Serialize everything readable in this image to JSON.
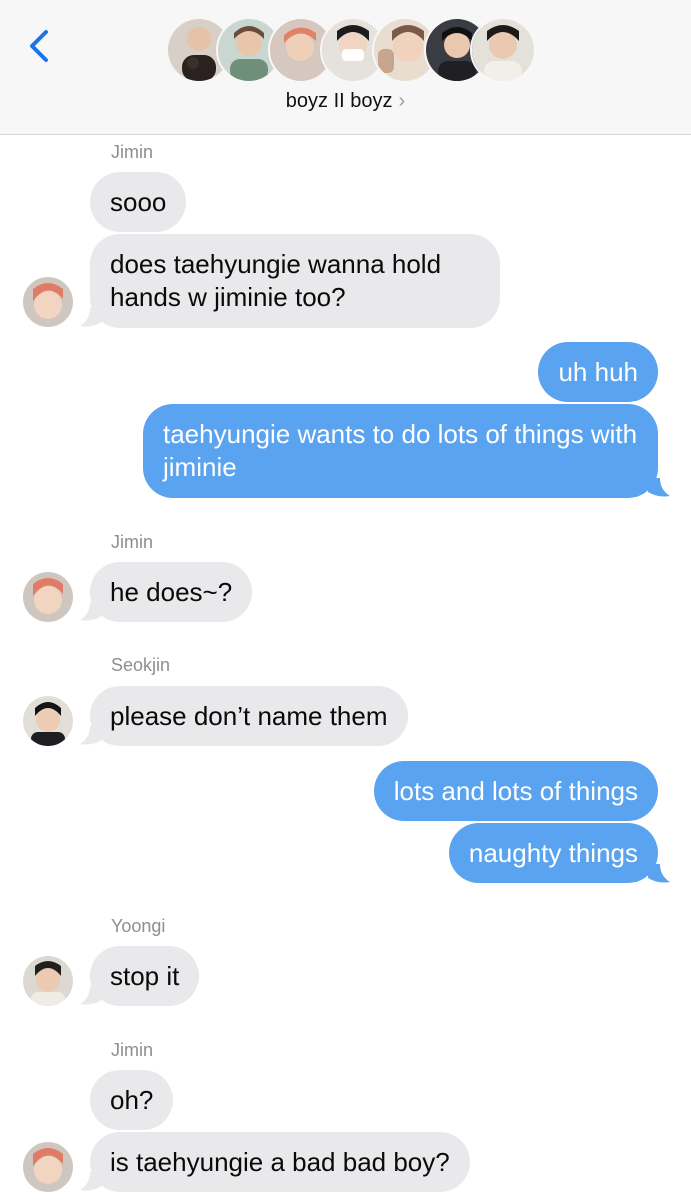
{
  "header": {
    "title": "boyz II boyz",
    "title_chevron": "›",
    "back_icon": "chevron-left-icon",
    "avatars": [
      "member-1",
      "member-2",
      "member-3",
      "member-4",
      "member-5",
      "member-6",
      "member-7"
    ]
  },
  "colors": {
    "incoming_bubble": "#e9e9eb",
    "outgoing_bubble": "#5aa3f0",
    "accent": "#1a73e8"
  },
  "messages": {
    "g1_sender": "Jimin",
    "m1": "sooo",
    "m2": "does taehyungie wanna hold hands w jiminie too?",
    "m3": "uh huh",
    "m4": "taehyungie wants to do lots of things with jiminie",
    "g2_sender": "Jimin",
    "m5": "he does~?",
    "g3_sender": "Seokjin",
    "m6": "please don’t name them",
    "m7": "lots and lots of things",
    "m8": "naughty things",
    "g4_sender": "Yoongi",
    "m9": "stop it",
    "g5_sender": "Jimin",
    "m10": "oh?",
    "m11": "is taehyungie a bad bad boy?"
  }
}
